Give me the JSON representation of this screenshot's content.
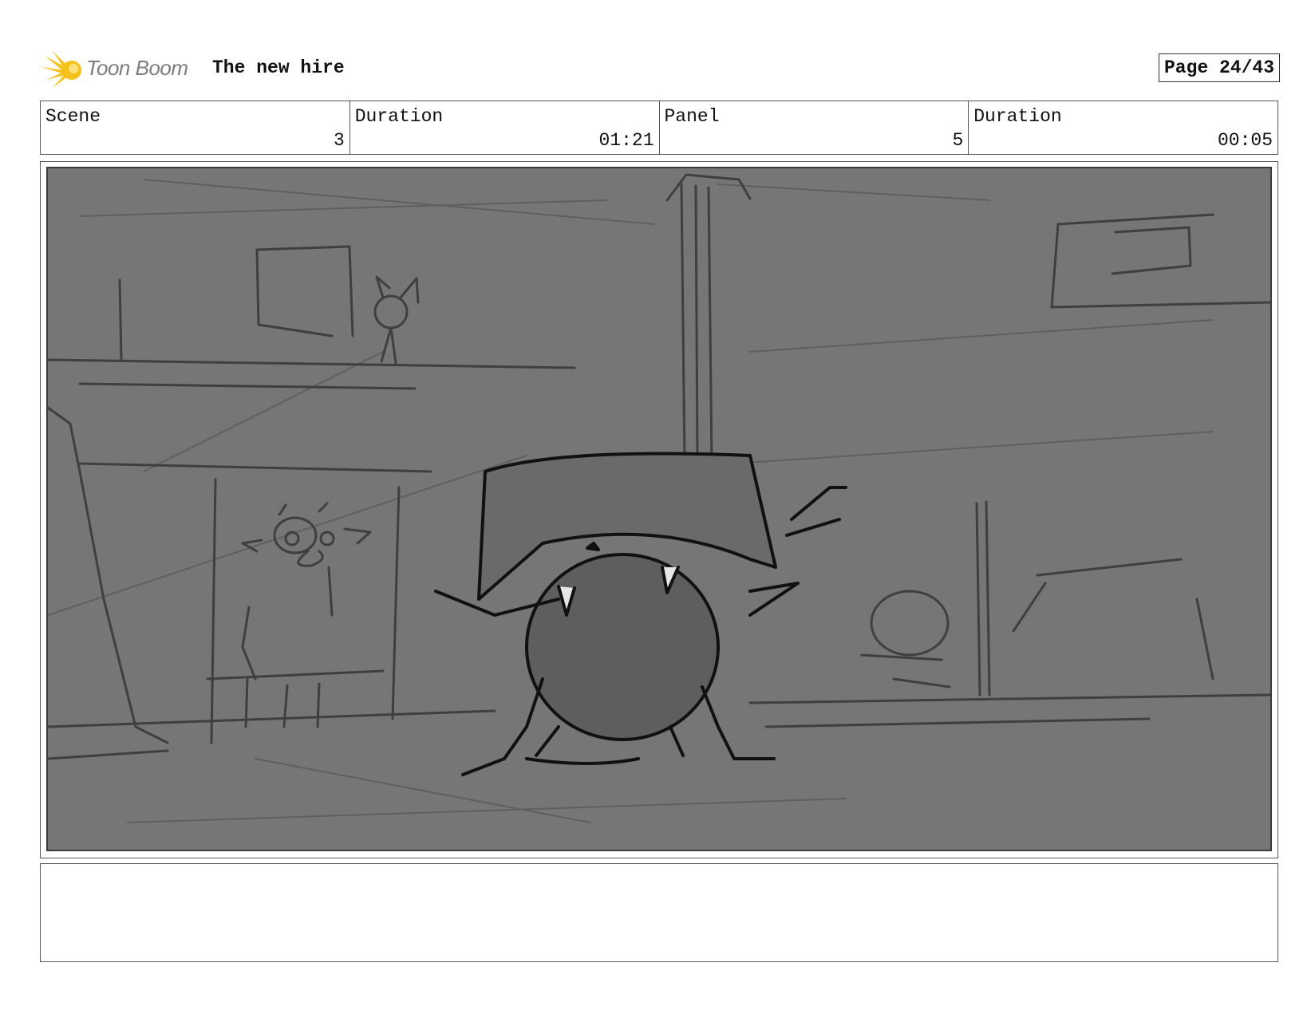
{
  "header": {
    "logo_text": "Toon Boom",
    "title": "The new hire",
    "page_label": "Page 24/43"
  },
  "info": {
    "scene_label": "Scene",
    "scene_value": "3",
    "scene_duration_label": "Duration",
    "scene_duration_value": "01:21",
    "panel_label": "Panel",
    "panel_value": "5",
    "panel_duration_label": "Duration",
    "panel_duration_value": "00:05"
  },
  "panel": {
    "background_color": "#767676",
    "description": ""
  },
  "notes": {
    "text": ""
  }
}
